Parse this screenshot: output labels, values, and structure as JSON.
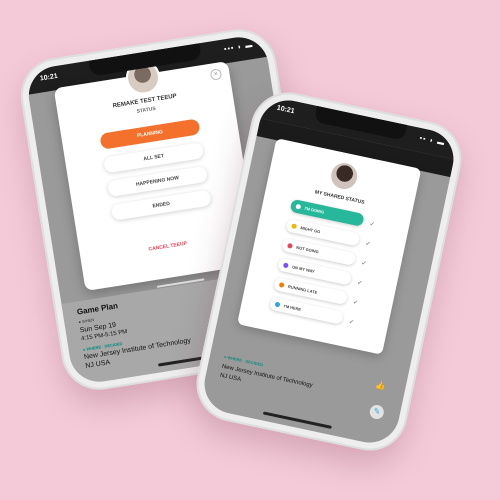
{
  "phone1": {
    "status_time": "10:21",
    "status_icons": "▪▪▪ ◗ ▬",
    "modal": {
      "title": "REMAKE TEST TEEUP",
      "subtitle": "STATUS",
      "options": [
        {
          "label": "PLANNING",
          "selected": true
        },
        {
          "label": "ALL SET",
          "selected": false
        },
        {
          "label": "HAPPENING NOW",
          "selected": false
        },
        {
          "label": "ENDED",
          "selected": false
        }
      ],
      "cancel_label": "CANCEL TEEUP",
      "close_glyph": "×"
    },
    "game_plan": {
      "title": "Game Plan",
      "meta": "● WHEN",
      "date": "Sun Sep 19",
      "time": "4:15 PM-5:15 PM",
      "tag": "● WHERE · DECIDED",
      "location_line1": "New Jersey Institute of Technology",
      "location_line2": "NJ USA"
    },
    "icons": {
      "like": "👍",
      "chat": "✎"
    }
  },
  "phone2": {
    "status_time": "10:21",
    "status_icons": "▪▪ ◗ ▬",
    "card": {
      "title": "MY SHARED STATUS",
      "statuses": [
        {
          "label": "I'M GOING",
          "active": true,
          "color": "#ffffff"
        },
        {
          "label": "MIGHT GO",
          "active": false,
          "color": "#f4b400"
        },
        {
          "label": "NOT GOING",
          "active": false,
          "color": "#e8455a"
        },
        {
          "label": "ON MY WAY",
          "active": false,
          "color": "#7c4dff"
        },
        {
          "label": "RUNNING LATE",
          "active": false,
          "color": "#f57c00"
        },
        {
          "label": "I'M HERE",
          "active": false,
          "color": "#2aa7e0"
        }
      ],
      "check_glyph": "✓"
    },
    "event": {
      "tag": "● WHERE · DECIDED",
      "location_line1": "New Jersey Institute of Technology",
      "location_line2": "NJ USA"
    },
    "icons": {
      "like": "👍",
      "chat": "✎"
    }
  }
}
